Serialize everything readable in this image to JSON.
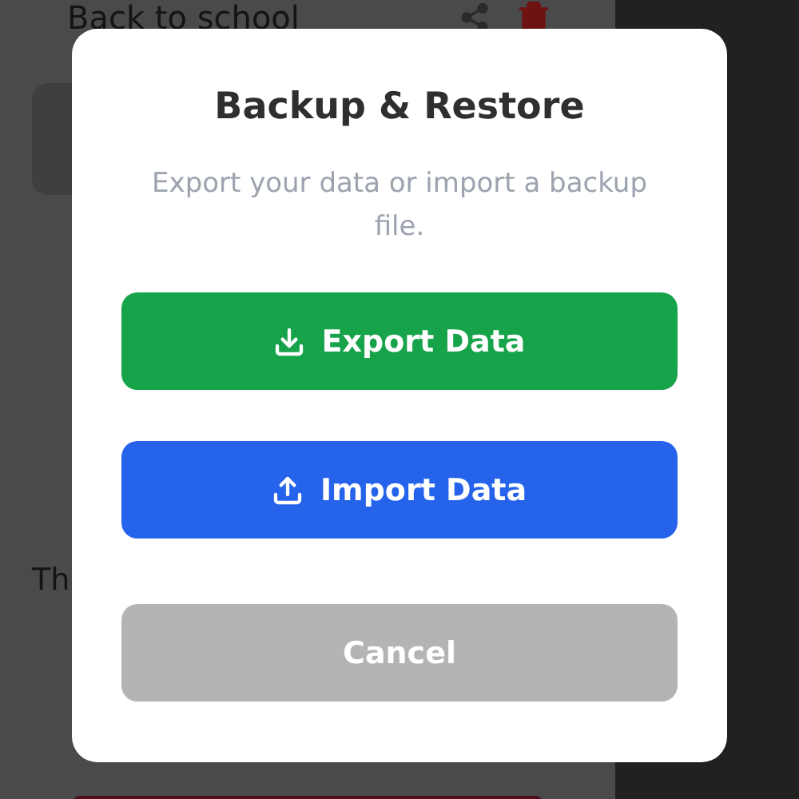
{
  "background": {
    "item_title": "Back to school",
    "partial_text": "Th"
  },
  "dialog": {
    "title": "Backup & Restore",
    "message": "Export your data or import a backup file.",
    "buttons": [
      {
        "label": "Export Data",
        "kind": "export"
      },
      {
        "label": "Import Data",
        "kind": "import"
      },
      {
        "label": "Cancel",
        "kind": "cancel"
      }
    ]
  }
}
